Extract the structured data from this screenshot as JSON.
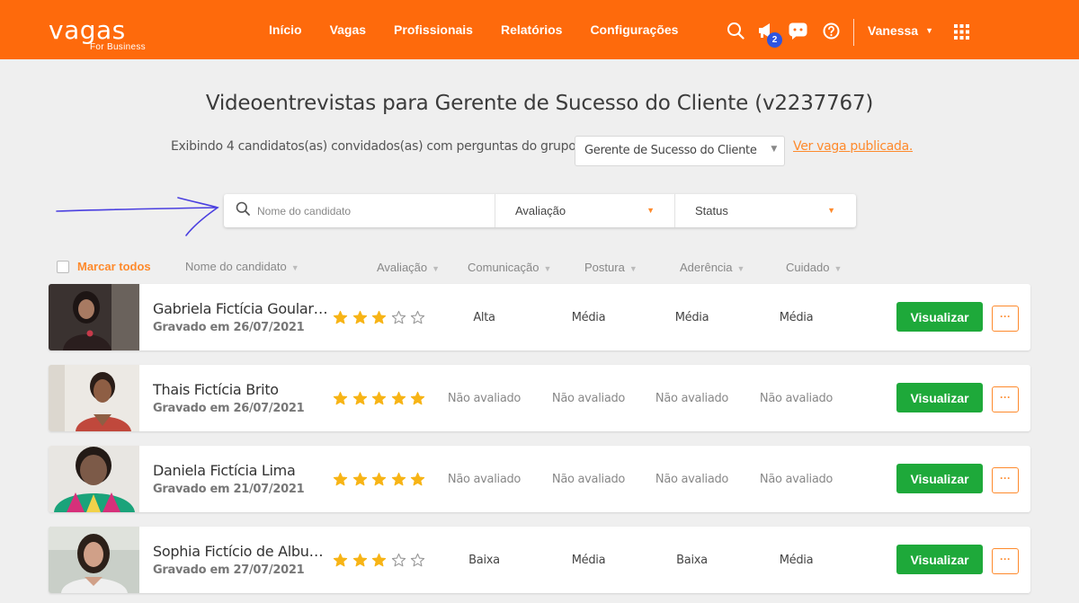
{
  "header": {
    "logo": "vagas",
    "logo_sub": "For Business",
    "nav": [
      {
        "label": "Início"
      },
      {
        "label": "Vagas"
      },
      {
        "label": "Profissionais"
      },
      {
        "label": "Relatórios"
      },
      {
        "label": "Configurações"
      }
    ],
    "notification_count": "2",
    "user_name": "Vanessa",
    "icons": [
      "search-icon",
      "megaphone-icon",
      "chat-icon",
      "help-icon",
      "apps-grid-icon"
    ]
  },
  "page": {
    "title": "Videoentrevistas para Gerente de Sucesso do Cliente (v2237767)",
    "subtitle": "Exibindo 4 candidatos(as) convidados(as) com perguntas do grupo.",
    "group_select": "Gerente de Sucesso do Cliente",
    "link": "Ver vaga publicada."
  },
  "filters": {
    "search_placeholder": "Nome do candidato",
    "rating_label": "Avaliação",
    "status_label": "Status"
  },
  "columns": {
    "mark_all": "Marcar todos",
    "name": "Nome do candidato",
    "rating": "Avaliação",
    "communication": "Comunicação",
    "posture": "Postura",
    "adherence": "Aderência",
    "care": "Cuidado"
  },
  "candidates": [
    {
      "name": "Gabriela Fictícia Goulart ...",
      "date": "Gravado em 26/07/2021",
      "rating": 3,
      "comunicacao": "Alta",
      "postura": "Média",
      "aderencia": "Média",
      "cuidado": "Média"
    },
    {
      "name": "Thais Fictícia Brito",
      "date": "Gravado em 26/07/2021",
      "rating": 5,
      "comunicacao": "Não avaliado",
      "postura": "Não avaliado",
      "aderencia": "Não avaliado",
      "cuidado": "Não avaliado"
    },
    {
      "name": "Daniela Fictícia Lima",
      "date": "Gravado em 21/07/2021",
      "rating": 5,
      "comunicacao": "Não avaliado",
      "postura": "Não avaliado",
      "aderencia": "Não avaliado",
      "cuidado": "Não avaliado"
    },
    {
      "name": "Sophia Fictício de Albuq...",
      "date": "Gravado em 27/07/2021",
      "rating": 3,
      "comunicacao": "Baixa",
      "postura": "Média",
      "aderencia": "Baixa",
      "cuidado": "Média"
    }
  ],
  "actions": {
    "view_label": "Visualizar",
    "more_label": "···"
  },
  "colors": {
    "brand_orange": "#fe6a0c",
    "accent_orange": "#fe8a2c",
    "button_green": "#1ea93a",
    "star_gold": "#f7b416",
    "badge_blue": "#2f55e0",
    "annotation_arrow": "#4a3fe0"
  }
}
